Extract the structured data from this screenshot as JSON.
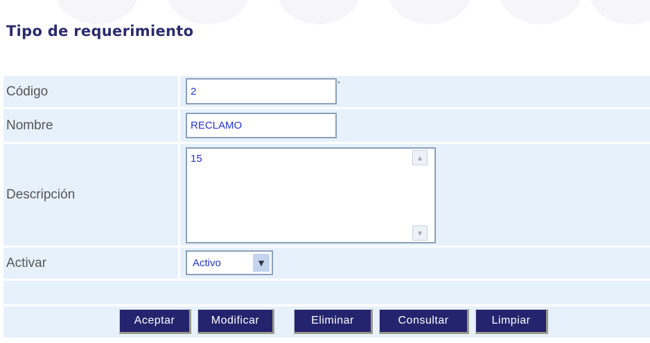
{
  "title": "Tipo de requerimiento",
  "fields": {
    "codigo": {
      "label": "Código",
      "value": "2",
      "required_mark": "*"
    },
    "nombre": {
      "label": "Nombre",
      "value": "RECLAMO"
    },
    "descripcion": {
      "label": "Descripción",
      "value": "15"
    },
    "activar": {
      "label": "Activar",
      "value": "Activo"
    }
  },
  "buttons": {
    "aceptar": "Aceptar",
    "modificar": "Modificar",
    "eliminar": "Eliminar",
    "consultar": "Consultar",
    "limpiar": "Limpiar"
  }
}
